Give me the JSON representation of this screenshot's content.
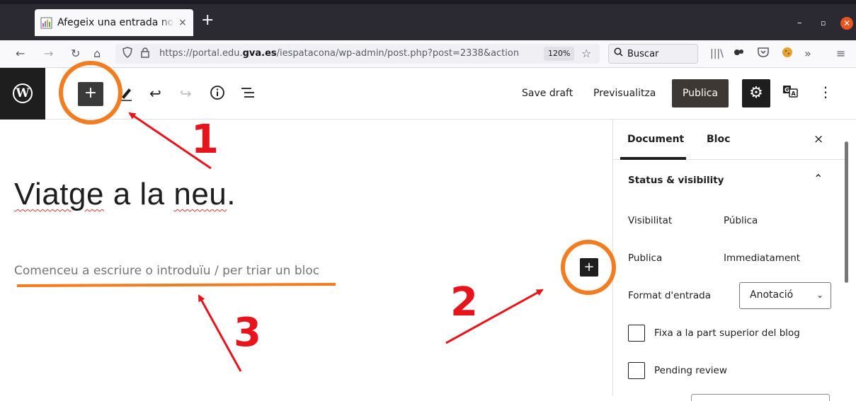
{
  "browser": {
    "tab_title": "Afegeix una entrada nova",
    "tab_close": "×",
    "new_tab": "+",
    "url_prefix": "https://portal.edu.",
    "url_domain": "gva.es",
    "url_suffix": "/iespatacona/wp-admin/post.php?post=2338&action",
    "zoom": "120%",
    "search_placeholder": "Buscar",
    "icons": [
      "back-icon",
      "forward-icon",
      "reload-icon",
      "home-icon",
      "shield-icon",
      "lock-icon",
      "star-icon",
      "search-icon",
      "library-icon",
      "extension-icon",
      "pocket-icon",
      "cookie-icon",
      "overflow-icon",
      "menu-icon"
    ]
  },
  "toolbar": {
    "add_block": "+",
    "save_draft": "Save draft",
    "preview": "Previsualitza",
    "publish": "Publica",
    "icons": [
      "wordpress-logo-icon",
      "add-block-icon",
      "edit-pencil-icon",
      "undo-icon",
      "redo-icon",
      "info-icon",
      "outline-list-icon",
      "settings-gear-icon",
      "translate-icon",
      "more-options-icon"
    ]
  },
  "editor": {
    "post_title": "Viatge a la neu.",
    "post_title_parts": [
      "Viatge",
      " a la ",
      "neu",
      "."
    ],
    "placeholder": "Comenceu a escriure o introduïu / per triar un bloc",
    "inline_add": "+"
  },
  "sidebar": {
    "tabs": [
      "Document",
      "Bloc"
    ],
    "active_tab": "Document",
    "close": "×",
    "panel_title": "Status & visibility",
    "rows": [
      {
        "label": "Visibilitat",
        "value": "Pública"
      },
      {
        "label": "Publica",
        "value": "Immediatament"
      }
    ],
    "format_label": "Format d'entrada",
    "format_value": "Anotació",
    "checkboxes": [
      {
        "label": "Fixa a la part superior del blog",
        "checked": false
      },
      {
        "label": "Pending review",
        "checked": false
      }
    ]
  },
  "annotations": {
    "labels": [
      "1",
      "2",
      "3"
    ],
    "highlight_color": "#f47c20",
    "arrow_color": "#e8141b"
  },
  "colors": {
    "browser_dark": "#2b2a33",
    "wp_dark": "#1e1e1e",
    "publish_button": "#3e3835",
    "close_red": "#e95420"
  }
}
